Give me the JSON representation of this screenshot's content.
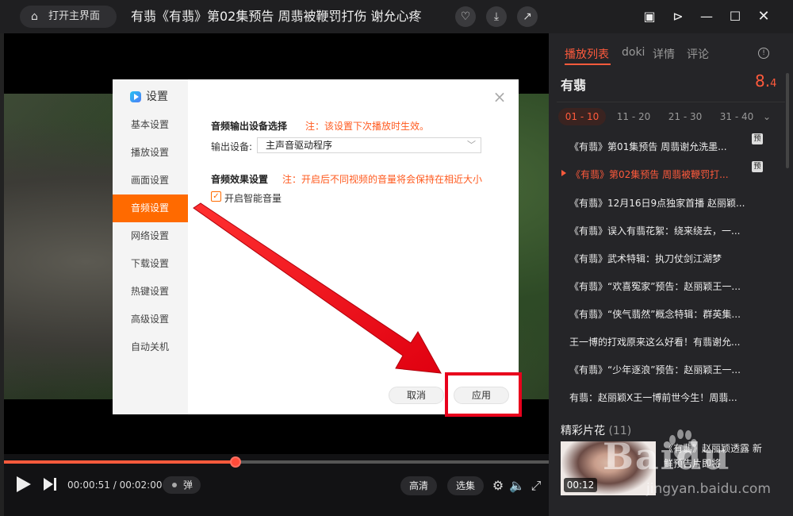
{
  "titlebar": {
    "home_label": "打开主界面",
    "title": "有翡《有翡》第02集预告 周翡被鞭罚打伤 谢允心疼"
  },
  "player": {
    "progress": 0.425,
    "time": "00:00:51 / 00:02:00",
    "danmu_label": "弹",
    "quality_label": "高清",
    "episodes_label": "选集"
  },
  "dialog": {
    "title": "设置",
    "menu": [
      "基本设置",
      "播放设置",
      "画面设置",
      "音频设置",
      "网络设置",
      "下载设置",
      "热键设置",
      "高级设置",
      "自动关机"
    ],
    "active_menu_index": 3,
    "output_section_title": "音频输出设备选择",
    "output_note": "注：该设置下次播放时生效。",
    "output_device_label": "输出设备:",
    "output_device_value": "主声音驱动程序",
    "effect_section_title": "音频效果设置",
    "effect_note": "注：开启后不同视频的音量将会保持在相近大小",
    "smart_volume_label": "开启智能音量",
    "smart_volume_checked": true,
    "cancel_label": "取消",
    "apply_label": "应用"
  },
  "panel": {
    "tabs": [
      "播放列表",
      "doki",
      "详情",
      "评论"
    ],
    "show_name": "有翡",
    "score_int": "8.",
    "score_dec": "4",
    "ranges": [
      "01 - 10",
      "11 - 20",
      "21 - 30",
      "31 - 40"
    ],
    "episodes": [
      {
        "title": "《有翡》第01集预告 周翡谢允洗墨...",
        "badge": "预"
      },
      {
        "title": "《有翡》第02集预告 周翡被鞭罚打...",
        "badge": "预",
        "active": true
      },
      {
        "title": "《有翡》12月16日9点独家首播 赵丽颖..."
      },
      {
        "title": "《有翡》误入有翡花絮：绕来绕去，一..."
      },
      {
        "title": "《有翡》武术特辑：执刀仗剑江湖梦"
      },
      {
        "title": "《有翡》“欢喜冤家”预告：赵丽颖王一..."
      },
      {
        "title": "《有翡》“侠气翡然”概念特辑：群英集..."
      },
      {
        "title": "王一博的打戏原来这么好看！有翡谢允..."
      },
      {
        "title": "《有翡》“少年逐浪”预告：赵丽颖王一..."
      },
      {
        "title": "有翡：赵丽颖X王一博前世今生！周翡..."
      }
    ],
    "clips_title": "精彩片花",
    "clips_count": "(11)",
    "clip": {
      "duration": "00:12",
      "title": "《有翡》赵丽颖透露 新鲜预告片即将"
    }
  },
  "watermark": {
    "brand": "Baidu",
    "url": "jingyan.baidu.com"
  },
  "colors": {
    "accent": "#ff6a00",
    "highlight": "#e8001c",
    "panel_accent": "#ff5a3c"
  }
}
